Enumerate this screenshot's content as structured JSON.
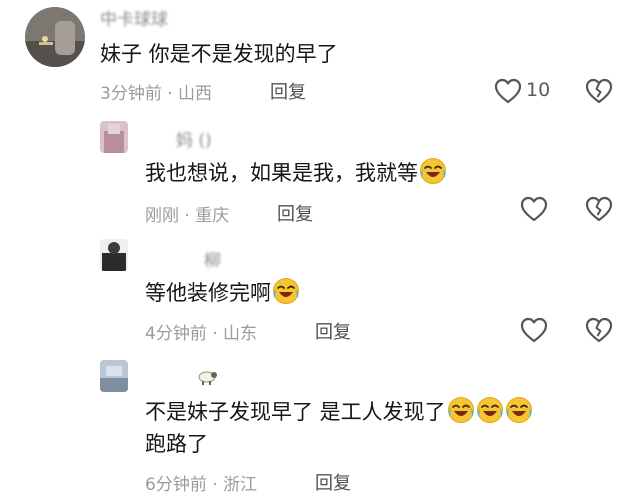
{
  "comments": [
    {
      "username": "中卡球球",
      "text": "妹子 你是不是发现的早了",
      "emojis": [],
      "time": "3分钟前",
      "location": "山西",
      "reply_label": "回复",
      "likes": "10",
      "avatar_color": "#6f6a64"
    },
    {
      "username": "妈 ()",
      "text": "我也想说，如果是我，我就等",
      "emojis": [
        "laughing-crying"
      ],
      "time": "刚刚",
      "location": "重庆",
      "reply_label": "回复",
      "likes": "",
      "avatar_color": "#c9a8b2"
    },
    {
      "username": "柳",
      "text": "等他装修完啊",
      "emojis": [
        "laughing-crying"
      ],
      "time": "4分钟前",
      "location": "山东",
      "reply_label": "回复",
      "likes": "",
      "avatar_color": "#2f2f2f"
    },
    {
      "username": "",
      "text": "不是妹子发现早了 是工人发现了",
      "text_line2": "跑路了",
      "emojis": [
        "laughing-crying",
        "laughing-crying",
        "laughing-crying"
      ],
      "time": "6分钟前",
      "location": "浙江",
      "reply_label": "回复",
      "likes": "",
      "avatar_color": "#8fa2b5"
    }
  ],
  "separator": "·",
  "icons": {
    "like": "heart-outline-icon",
    "dislike": "broken-heart-icon",
    "emoji": "face-with-tears-of-joy-icon"
  }
}
